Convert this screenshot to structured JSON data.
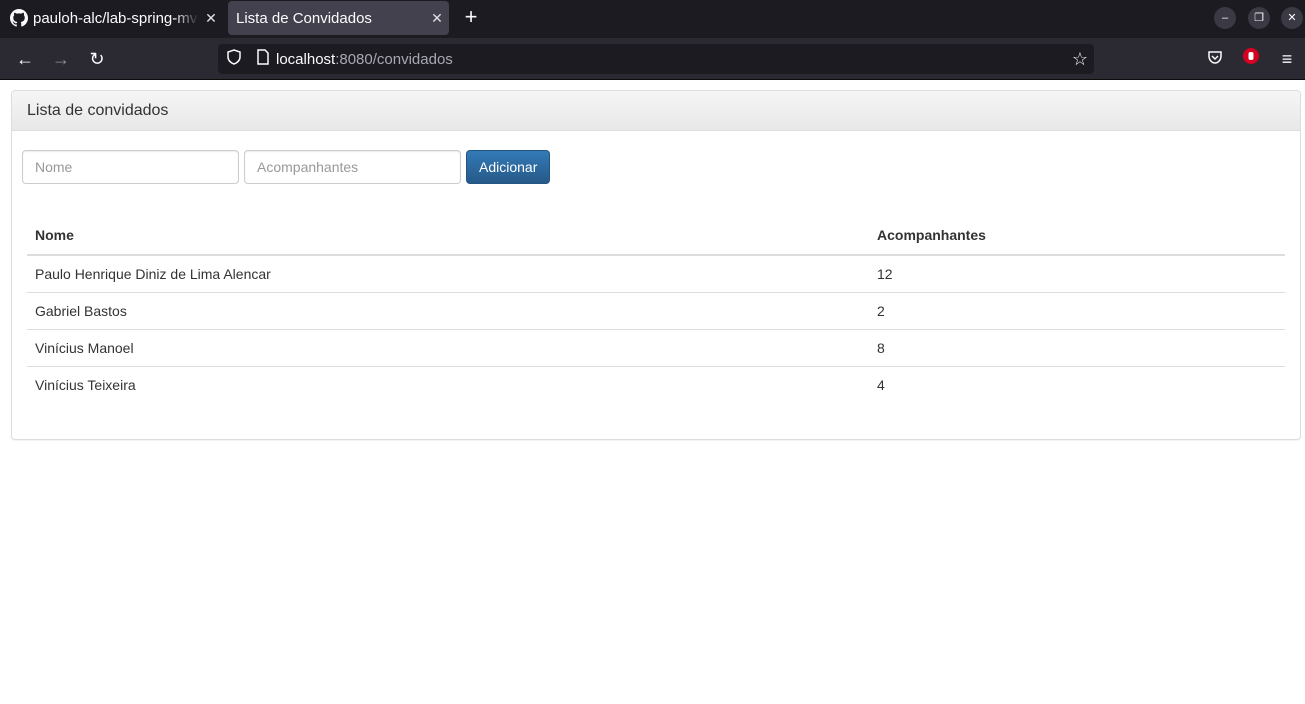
{
  "browser": {
    "tabs": [
      {
        "title": "pauloh-alc/lab-spring-mvc",
        "icon": "github-icon"
      },
      {
        "title": "Lista de Convidados",
        "icon": ""
      }
    ],
    "url": {
      "host": "localhost",
      "rest": ":8080/convidados"
    }
  },
  "panel": {
    "title": "Lista de convidados"
  },
  "form": {
    "nome_placeholder": "Nome",
    "acompanhantes_placeholder": "Acompanhantes",
    "submit_label": "Adicionar"
  },
  "table": {
    "headers": [
      "Nome",
      "Acompanhantes"
    ],
    "rows": [
      {
        "nome": "Paulo Henrique Diniz de Lima Alencar",
        "acompanhantes": "12"
      },
      {
        "nome": "Gabriel Bastos",
        "acompanhantes": "2"
      },
      {
        "nome": "Vinícius Manoel",
        "acompanhantes": "8"
      },
      {
        "nome": "Vinícius Teixeira",
        "acompanhantes": "4"
      }
    ]
  },
  "colors": {
    "primary_button": "#337ab7",
    "chrome_dark": "#1c1b22",
    "toolbar": "#2b2a33"
  }
}
